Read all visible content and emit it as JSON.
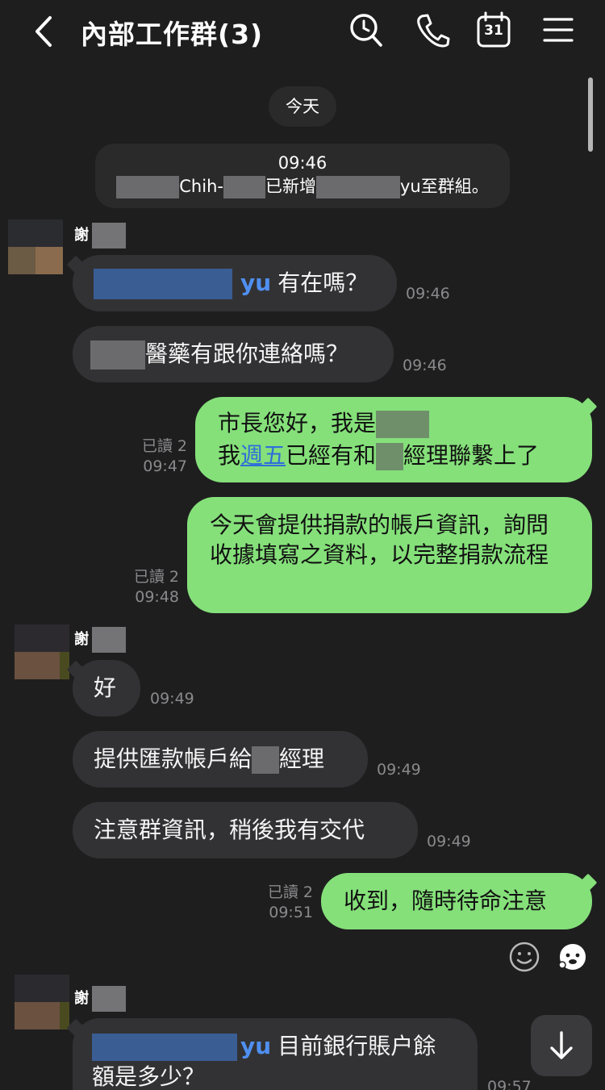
{
  "header": {
    "title": "內部工作群(3)",
    "calendar_day": "31"
  },
  "date_separator": "今天",
  "system_message": {
    "time": "09:46",
    "part1": "Chih-",
    "part2": "已新增",
    "part3": "yu至群組。"
  },
  "sender": {
    "surname": "謝"
  },
  "messages": {
    "m1": {
      "mention": "yu",
      "text": "有在嗎？",
      "time": "09:46"
    },
    "m2": {
      "text": "醫藥有跟你連絡嗎？",
      "time": "09:46"
    },
    "m3": {
      "line1": "市長您好，我是",
      "line2_pre": "我",
      "line2_link": "週五",
      "line2_mid": "已經有和",
      "line2_post": "經理聯繫上了",
      "read": "已讀 2",
      "time": "09:47"
    },
    "m4": {
      "text": "今天會提供捐款的帳戶資訊，詢問收據填寫之資料，以完整捐款流程",
      "read": "已讀 2",
      "time": "09:48"
    },
    "m5": {
      "text": "好",
      "time": "09:49"
    },
    "m6": {
      "text_pre": "提供匯款帳戶給",
      "text_post": "經理",
      "time": "09:49"
    },
    "m7": {
      "text": "注意群資訊，稍後我有交代",
      "time": "09:49"
    },
    "m8": {
      "text": "收到，隨時待命注意",
      "read": "已讀 2",
      "time": "09:51"
    },
    "m9": {
      "mention": "yu",
      "text": "目前銀行賬户餘額是多少？",
      "time": "09:57"
    }
  },
  "icons": [
    "back-icon",
    "search-icon",
    "phone-icon",
    "calendar-icon",
    "menu-icon",
    "smiley-icon",
    "sticker-icon",
    "scroll-down-icon"
  ]
}
